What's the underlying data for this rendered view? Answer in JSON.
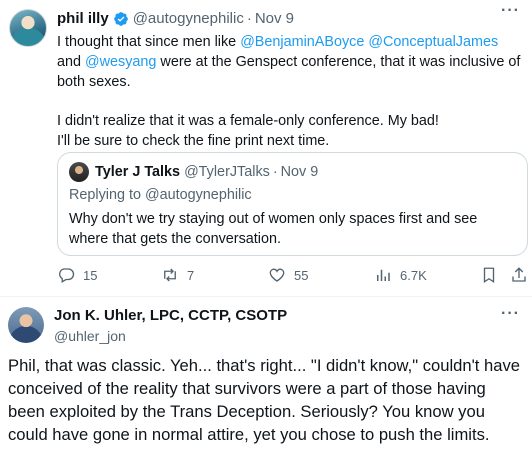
{
  "tweet": {
    "author_name": "phil illy",
    "author_handle": "@autogynephilic",
    "separator": "·",
    "time": "Nov 9",
    "body": {
      "line1_prefix": "I thought that since men like ",
      "mention1": "@BenjaminABoyce",
      "mention2": "@ConceptualJames",
      "line1_suffix": " and",
      "mention3": "@wesyang",
      "line2_suffix": " were at the Genspect conference, that it was inclusive of both sexes.",
      "para2_line1": "I didn't realize that it was a female-only conference. My bad!",
      "para2_line2": "I'll be sure to check the fine print next time."
    },
    "quote": {
      "author_name": "Tyler J Talks",
      "author_handle": "@TylerJTalks",
      "time": "Nov 9",
      "replying_to": "Replying to @autogynephilic",
      "text": "Why don't we try staying out of women only spaces first and see where that gets the conversation."
    },
    "actions": {
      "replies": "15",
      "retweets": "7",
      "likes": "55",
      "views": "6.7K"
    },
    "colors": {
      "accent": "#1d9bf0",
      "secondary_text": "#536471"
    }
  },
  "reply": {
    "author_name": "Jon K. Uhler, LPC, CCTP, CSOTP",
    "author_handle": "@uhler_jon",
    "text": "Phil, that was classic. Yeh... that's right... \"I didn't know,\" couldn't have conceived of the reality that survivors were a part of those having been exploited by the Trans Deception. Seriously? You know you could have gone in normal attire, yet you chose to push the limits."
  },
  "icons": {
    "more": "more-icon",
    "verified": "verified-badge-icon",
    "reply": "reply-icon",
    "retweet": "retweet-icon",
    "like": "heart-icon",
    "views": "views-icon",
    "bookmark": "bookmark-icon",
    "share": "share-icon"
  }
}
